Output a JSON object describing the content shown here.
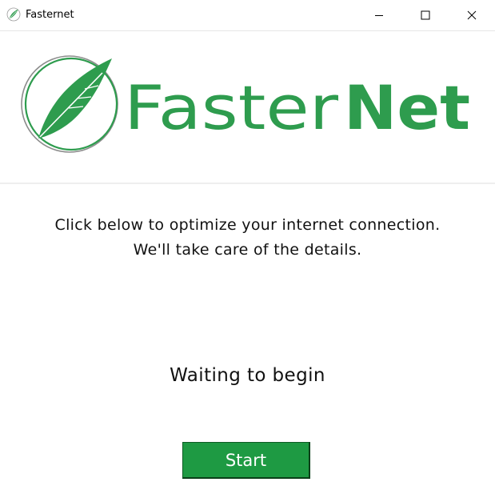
{
  "window": {
    "title": "Fasternet",
    "controls": {
      "minimize": "minimize",
      "maximize": "maximize",
      "close": "close"
    }
  },
  "logo": {
    "word_light": "Faster",
    "word_bold": "Net",
    "brand_color": "#2e9c4e",
    "icon": "feather-icon"
  },
  "main": {
    "message_line1": "Click below to optimize your internet connection.",
    "message_line2": "We'll take care of the details.",
    "status": "Waiting to begin",
    "start_label": "Start"
  },
  "colors": {
    "button_bg": "#1e9a43",
    "button_text": "#ffffff"
  }
}
